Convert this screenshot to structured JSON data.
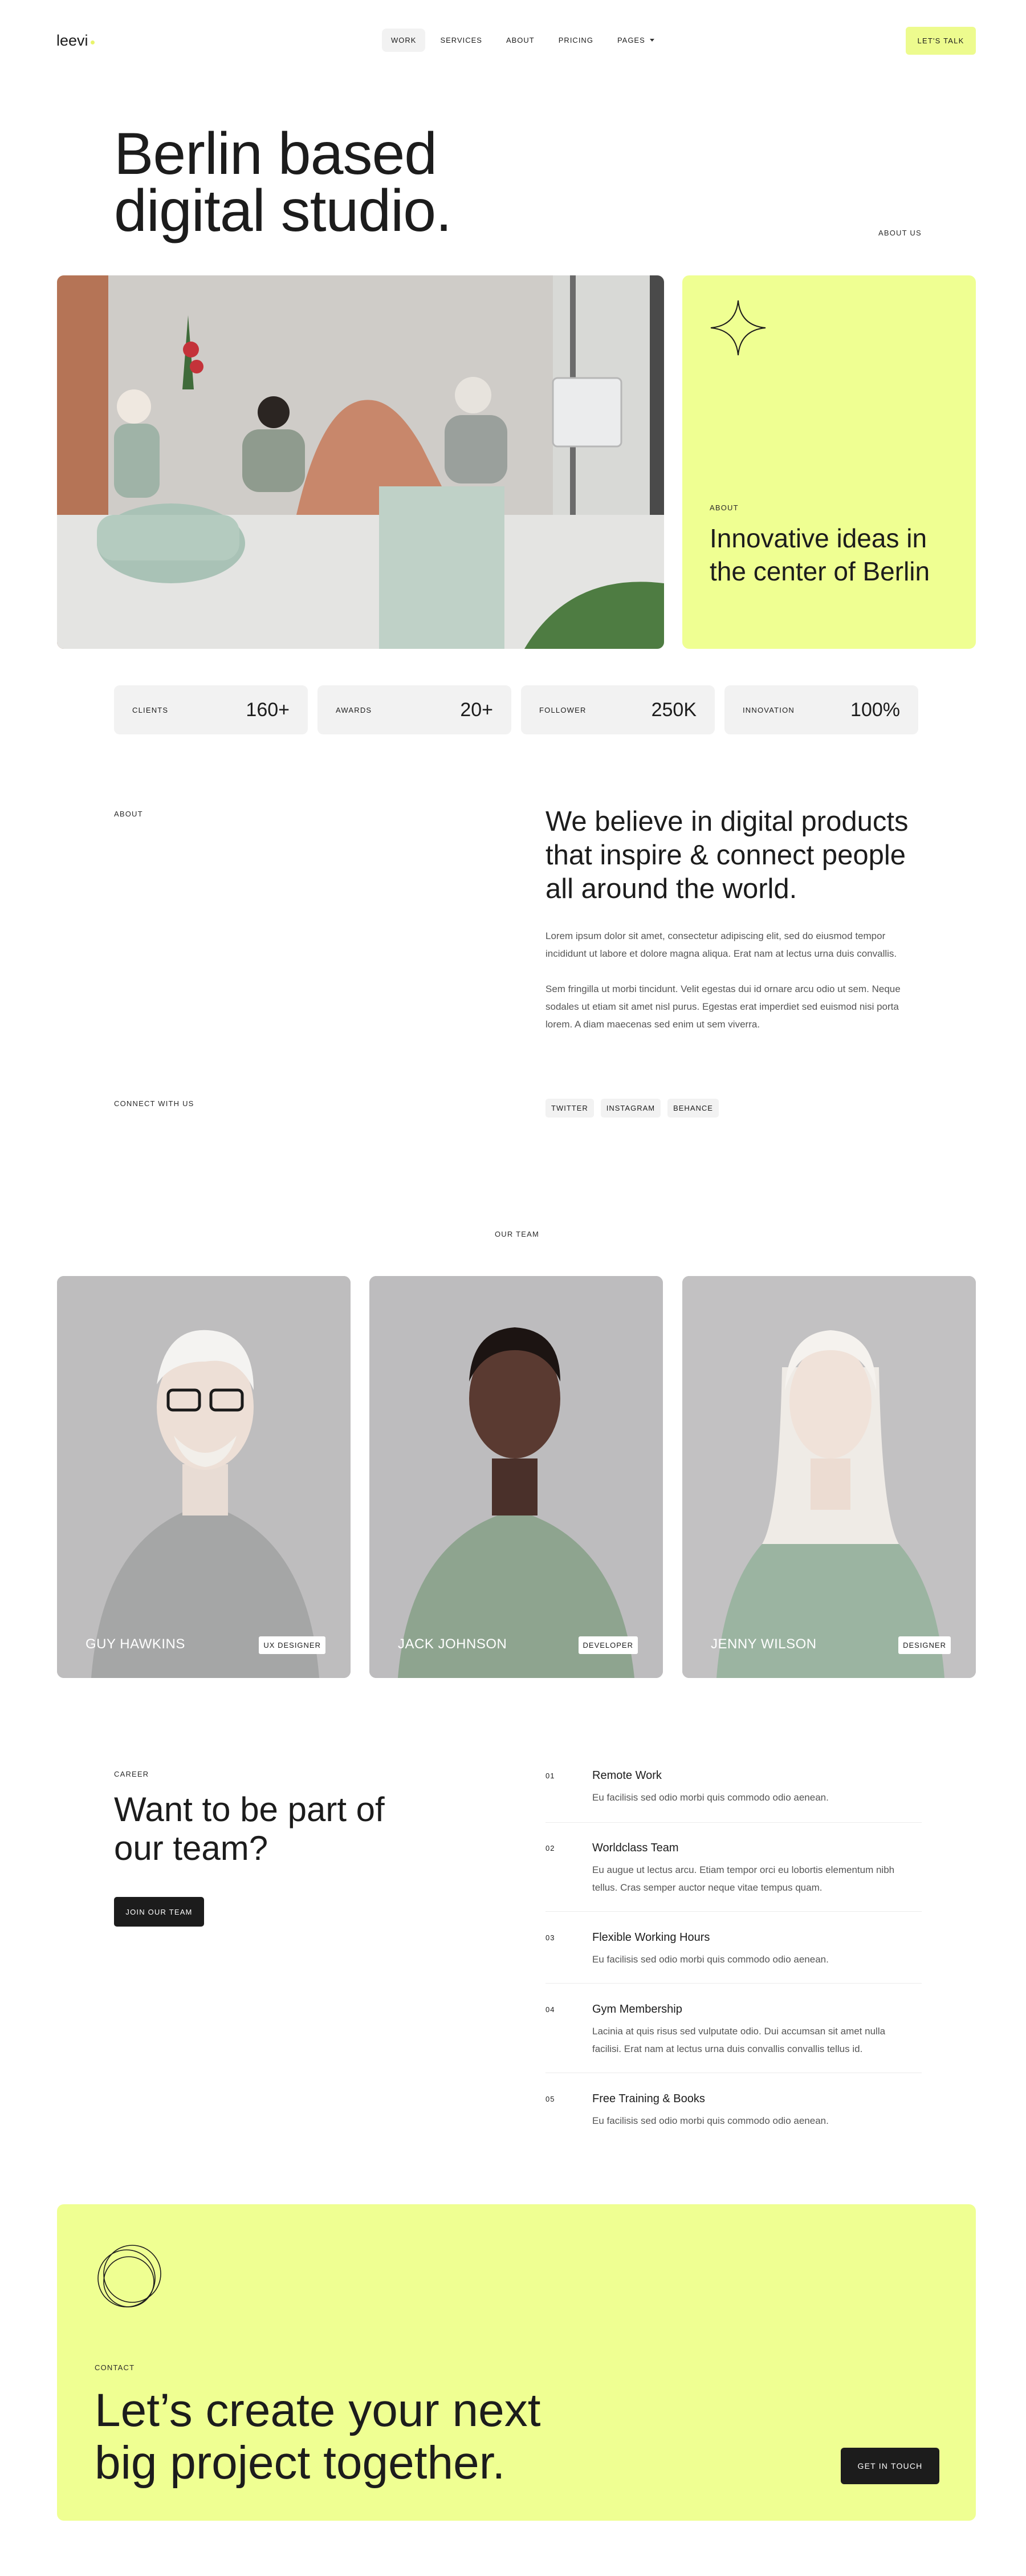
{
  "header": {
    "logo": "leevi",
    "nav": [
      {
        "label": "WORK",
        "active": true
      },
      {
        "label": "SERVICES",
        "active": false
      },
      {
        "label": "ABOUT",
        "active": false
      },
      {
        "label": "PRICING",
        "active": false
      },
      {
        "label": "PAGES",
        "active": false
      }
    ],
    "cta": "LET'S TALK"
  },
  "hero": {
    "title": "Berlin based digital studio.",
    "about_link": "ABOUT US",
    "image_icon": "team-photo-image",
    "about_card": {
      "label": "ABOUT",
      "text": "Innovative ideas in the center of Berlin",
      "icon": "sparkle-star-icon"
    }
  },
  "stats": [
    {
      "label": "CLIENTS",
      "value": "160+"
    },
    {
      "label": "AWARDS",
      "value": "20+"
    },
    {
      "label": "FOLLOWER",
      "value": "250K"
    },
    {
      "label": "INNOVATION",
      "value": "100%"
    }
  ],
  "about": {
    "label": "ABOUT",
    "title": "We believe in digital products that inspire & connect people all around the world.",
    "paragraphs": [
      "Lorem ipsum dolor sit amet, consectetur adipiscing elit, sed do eiusmod tempor incididunt ut labore et dolore magna aliqua. Erat nam at lectus urna duis convallis.",
      "Sem fringilla ut morbi tincidunt. Velit egestas dui id ornare arcu odio ut sem. Neque sodales ut etiam sit amet nisl purus. Egestas erat imperdiet sed euismod nisi porta lorem. A diam maecenas sed enim ut sem viverra."
    ],
    "connect_label": "CONNECT WITH US",
    "socials": [
      "TWITTER",
      "INSTAGRAM",
      "BEHANCE"
    ]
  },
  "team": {
    "label": "OUR TEAM",
    "members": [
      {
        "name": "GUY HAWKINS",
        "role": "UX DESIGNER"
      },
      {
        "name": "JACK JOHNSON",
        "role": "DEVELOPER"
      },
      {
        "name": "JENNY WILSON",
        "role": "DESIGNER"
      }
    ]
  },
  "career": {
    "label": "CAREER",
    "title": "Want to be part of our team?",
    "button": "JOIN OUR TEAM",
    "perks": [
      {
        "num": "01",
        "title": "Remote Work",
        "desc": "Eu facilisis sed odio morbi quis commodo odio aenean."
      },
      {
        "num": "02",
        "title": "Worldclass Team",
        "desc": "Eu augue ut lectus arcu. Etiam tempor orci eu lobortis elementum nibh tellus. Cras semper auctor neque vitae tempus quam."
      },
      {
        "num": "03",
        "title": "Flexible Working Hours",
        "desc": "Eu facilisis sed odio morbi quis commodo odio aenean."
      },
      {
        "num": "04",
        "title": "Gym Membership",
        "desc": "Lacinia at quis risus sed vulputate odio. Dui accumsan sit amet nulla facilisi. Erat nam at lectus urna duis convallis convallis tellus id."
      },
      {
        "num": "05",
        "title": "Free Training & Books",
        "desc": "Eu facilisis sed odio morbi quis commodo odio aenean."
      }
    ]
  },
  "contact": {
    "label": "CONTACT",
    "title": "Let’s create your next big project together.",
    "button": "GET IN TOUCH",
    "icon": "overlapping-circles-icon"
  },
  "colors": {
    "accent": "#efff92",
    "dark": "#1c1c1c",
    "muted_bg": "#f2f2f2"
  }
}
